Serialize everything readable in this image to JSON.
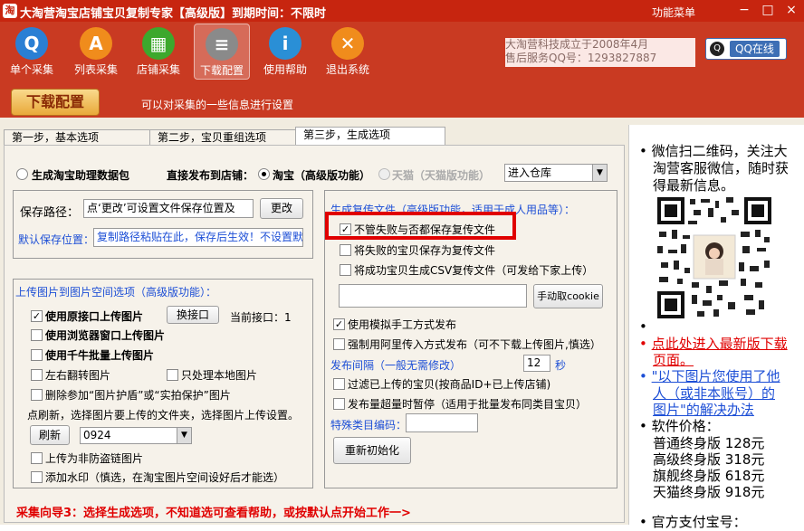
{
  "window": {
    "title": "大淘营淘宝店铺宝贝复制专家【高级版】到期时间：不限时",
    "menu": "功能菜单",
    "minimize": "−",
    "maximize": "□",
    "close": "×"
  },
  "toolbar": {
    "items": [
      {
        "label": "单个采集",
        "icon": "single-collect-icon",
        "color": "#2a7fd4",
        "glyph": "Q"
      },
      {
        "label": "列表采集",
        "icon": "list-collect-icon",
        "color": "#f08c1c",
        "glyph": "A"
      },
      {
        "label": "店铺采集",
        "icon": "shop-collect-icon",
        "color": "#3da82d",
        "glyph": "▦"
      },
      {
        "label": "下载配置",
        "icon": "download-config-icon",
        "color": "#8a8a8a",
        "glyph": "≡"
      },
      {
        "label": "使用帮助",
        "icon": "help-icon",
        "color": "#2a8fd6",
        "glyph": "i"
      },
      {
        "label": "退出系统",
        "icon": "exit-icon",
        "color": "#f08c1c",
        "glyph": "✕"
      }
    ]
  },
  "company": {
    "line1": "大淘营科技成立于2008年4月",
    "line2": "售后服务QQ号：1293827887"
  },
  "qq": {
    "label": "QQ在线"
  },
  "section": {
    "title": "下载配置",
    "desc": "可以对采集的一些信息进行设置"
  },
  "tabs": [
    "第一步，基本选项",
    "第二步，宝贝重组选项",
    "第三步，生成选项"
  ],
  "top_options": {
    "radio1": "生成淘宝助理数据包",
    "publish_label": "直接发布到店铺：",
    "radio2": "淘宝（高级版功能）",
    "radio3": "天猫（天猫版功能）",
    "warehouse": "进入仓库"
  },
  "save": {
    "label": "保存路径：",
    "value": "点‘更改’可设置文件保存位置及",
    "change_btn": "更改",
    "default_label": "默认保存位置：",
    "default_value": "复制路径粘贴在此，保存后生效！不设置默"
  },
  "upload": {
    "title": "上传图片到图片空间选项（高级版功能）：",
    "opt1": "使用原接口上传图片",
    "switch_btn": "换接口",
    "current_if": "当前接口：1",
    "opt2": "使用浏览器窗口上传图片",
    "opt3": "使用千牛批量上传图片",
    "opt4": "左右翻转图片",
    "opt5": "只处理本地图片",
    "opt6": "删除参加“图片护盾”或“实拍保护”图片",
    "refresh_note": "点刷新，选择图片要上传的文件夹，选择图片上传设置。",
    "refresh_btn": "刷新",
    "folder": "0924",
    "opt7": "上传为非防盗链图片",
    "opt8": "添加水印（慎选，在淘宝图片空间设好后才能选）"
  },
  "gen": {
    "title": "生成复传文件（高级版功能，适用于成人用品等）：",
    "opt1": "不管失败与否都保存复传文件",
    "opt2": "将失败的宝贝保存为复传文件",
    "opt3": "将成功宝贝生成CSV复传文件（可发给下家上传）",
    "cookie_btn": "手动取cookie",
    "opt4": "使用模拟手工方式发布",
    "opt5": "强制用阿里传入方式发布（可不下载上传图片,慎选）",
    "interval_label": "发布间隔（一般无需修改）",
    "interval_value": "12",
    "interval_unit": "秒",
    "opt6": "过滤已上传的宝贝(按商品ID+已上传店铺)",
    "opt7": "发布量超量时暂停（适用于批量发布同类目宝贝）",
    "special_label": "特殊类目编码：",
    "reinit_btn": "重新初始化"
  },
  "guide": "采集向导3：选择生成选项，不知道选可查看帮助，或按默认点开始工作一>",
  "side": {
    "wechat1": "微信扫二维码，关注大",
    "wechat2": "淘营客服微信，随时获",
    "wechat3": "得最新信息。",
    "dl1": "点此处进入最新版下载",
    "dl2": "页面。",
    "link1": "\"以下图片您使用了他",
    "link2": "人（或非本账号）的",
    "link3": "图片\"的解决办法",
    "price_title": "软件价格：",
    "prices": [
      "普通终身版  128元",
      "高级终身版  318元",
      "旗舰终身版  618元",
      "天猫终身版  918元"
    ],
    "pay": "官方支付宝号："
  },
  "colors": {
    "brand": "#c93a22",
    "highlight": "#e00000",
    "link": "#1d4fd6"
  }
}
